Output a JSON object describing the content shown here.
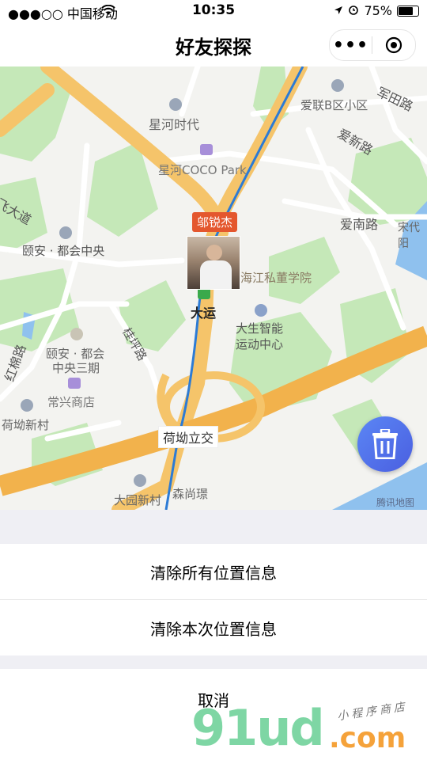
{
  "status_bar": {
    "carrier": "●●●○○ 中国移动",
    "time": "10:35",
    "battery": "75%"
  },
  "nav": {
    "title": "好友探探",
    "more_glyph": "•••"
  },
  "map": {
    "user_name": "邬锐杰",
    "labels": {
      "xinghe_shidai": "星河时代",
      "coco_park": "星河COCO Park",
      "ailian": "爱联B区小区",
      "juntian": "军田路",
      "aixin": "爱新路",
      "ainan": "爱南路",
      "songdai": "宋代阳",
      "feida": "飞大道",
      "yian_center": "颐安 · 都会中央",
      "school": "海江私董学院",
      "dayun": "大运",
      "dasheng": "大生智能",
      "dasheng2": "运动中心",
      "guiping": "桂坪路",
      "hongmian": "红棉路",
      "yian2": "颐安 · 都会",
      "yian3": "中央三期",
      "changxing": "常兴商店",
      "heao_village": "荷坳新村",
      "heao_interchange": "荷坳立交",
      "dayuan": "大园新村",
      "sensh": "森尚璟",
      "tencent": "腾讯地图"
    }
  },
  "actions": {
    "clear_all": "清除所有位置信息",
    "clear_current": "清除本次位置信息",
    "cancel": "取消"
  },
  "watermark": {
    "brand": "91ud",
    "domain": ".com",
    "tagline": "小程序商店"
  }
}
